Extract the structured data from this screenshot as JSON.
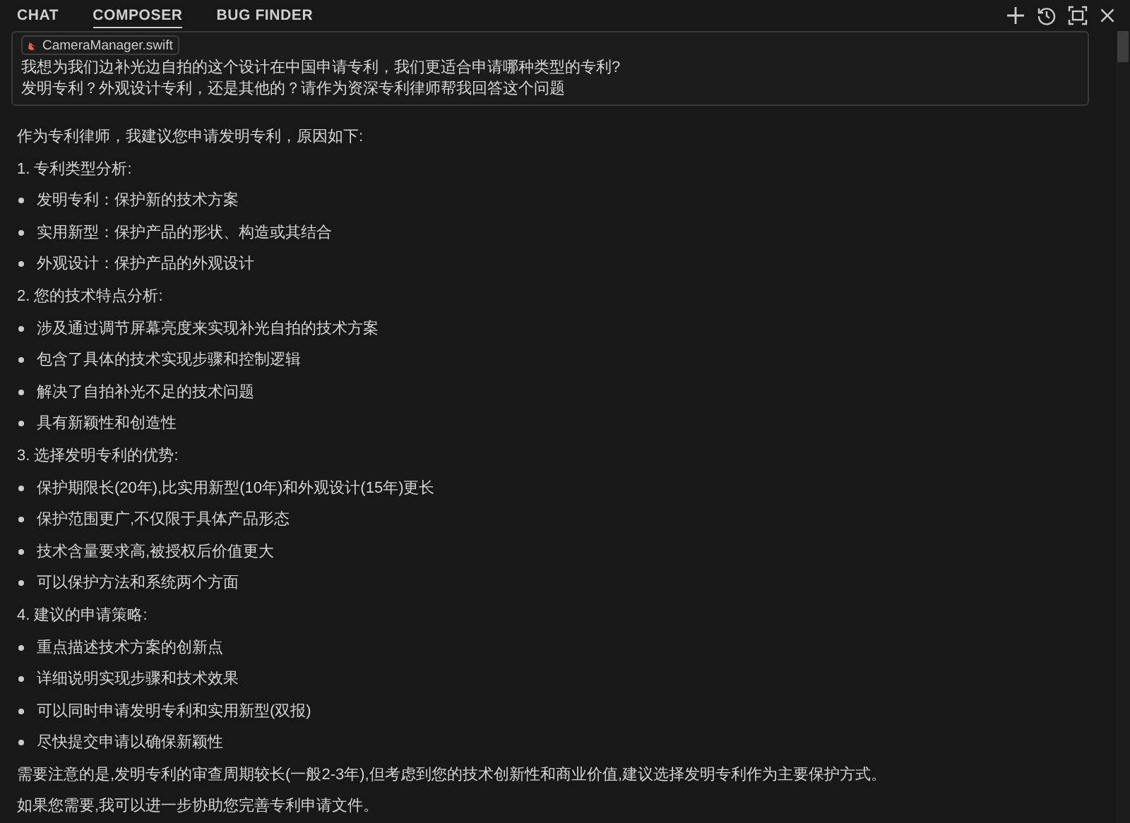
{
  "tabs": [
    {
      "label": "CHAT",
      "selected": false
    },
    {
      "label": "COMPOSER",
      "selected": true
    },
    {
      "label": "BUG FINDER",
      "selected": false
    }
  ],
  "user_message": {
    "attachment": "CameraManager.swift",
    "lines": [
      "我想为我们边补光边自拍的这个设计在中国申请专利，我们更适合申请哪种类型的专利?",
      "发明专利？外观设计专利，还是其他的？请作为资深专利律师帮我回答这个问题"
    ]
  },
  "response": {
    "intro": "作为专利律师，我建议您申请发明专利，原因如下:",
    "sections": [
      {
        "heading": "1. 专利类型分析:",
        "bullets": [
          "发明专利：保护新的技术方案",
          "实用新型：保护产品的形状、构造或其结合",
          "外观设计：保护产品的外观设计"
        ]
      },
      {
        "heading": "2. 您的技术特点分析:",
        "bullets": [
          "涉及通过调节屏幕亮度来实现补光自拍的技术方案",
          "包含了具体的技术实现步骤和控制逻辑",
          "解决了自拍补光不足的技术问题",
          "具有新颖性和创造性"
        ]
      },
      {
        "heading": "3. 选择发明专利的优势:",
        "bullets": [
          "保护期限长(20年),比实用新型(10年)和外观设计(15年)更长",
          "保护范围更广,不仅限于具体产品形态",
          "技术含量要求高,被授权后价值更大",
          "可以保护方法和系统两个方面"
        ]
      },
      {
        "heading": "4. 建议的申请策略:",
        "bullets": [
          "重点描述技术方案的创新点",
          "详细说明实现步骤和技术效果",
          "可以同时申请发明专利和实用新型(双报)",
          "尽快提交申请以确保新颖性"
        ]
      }
    ],
    "closing": [
      "需要注意的是,发明专利的审查周期较长(一般2-3年),但考虑到您的技术创新性和商业价值,建议选择发明专利作为主要保护方式。",
      "如果您需要,我可以进一步协助您完善专利申请文件。"
    ]
  }
}
